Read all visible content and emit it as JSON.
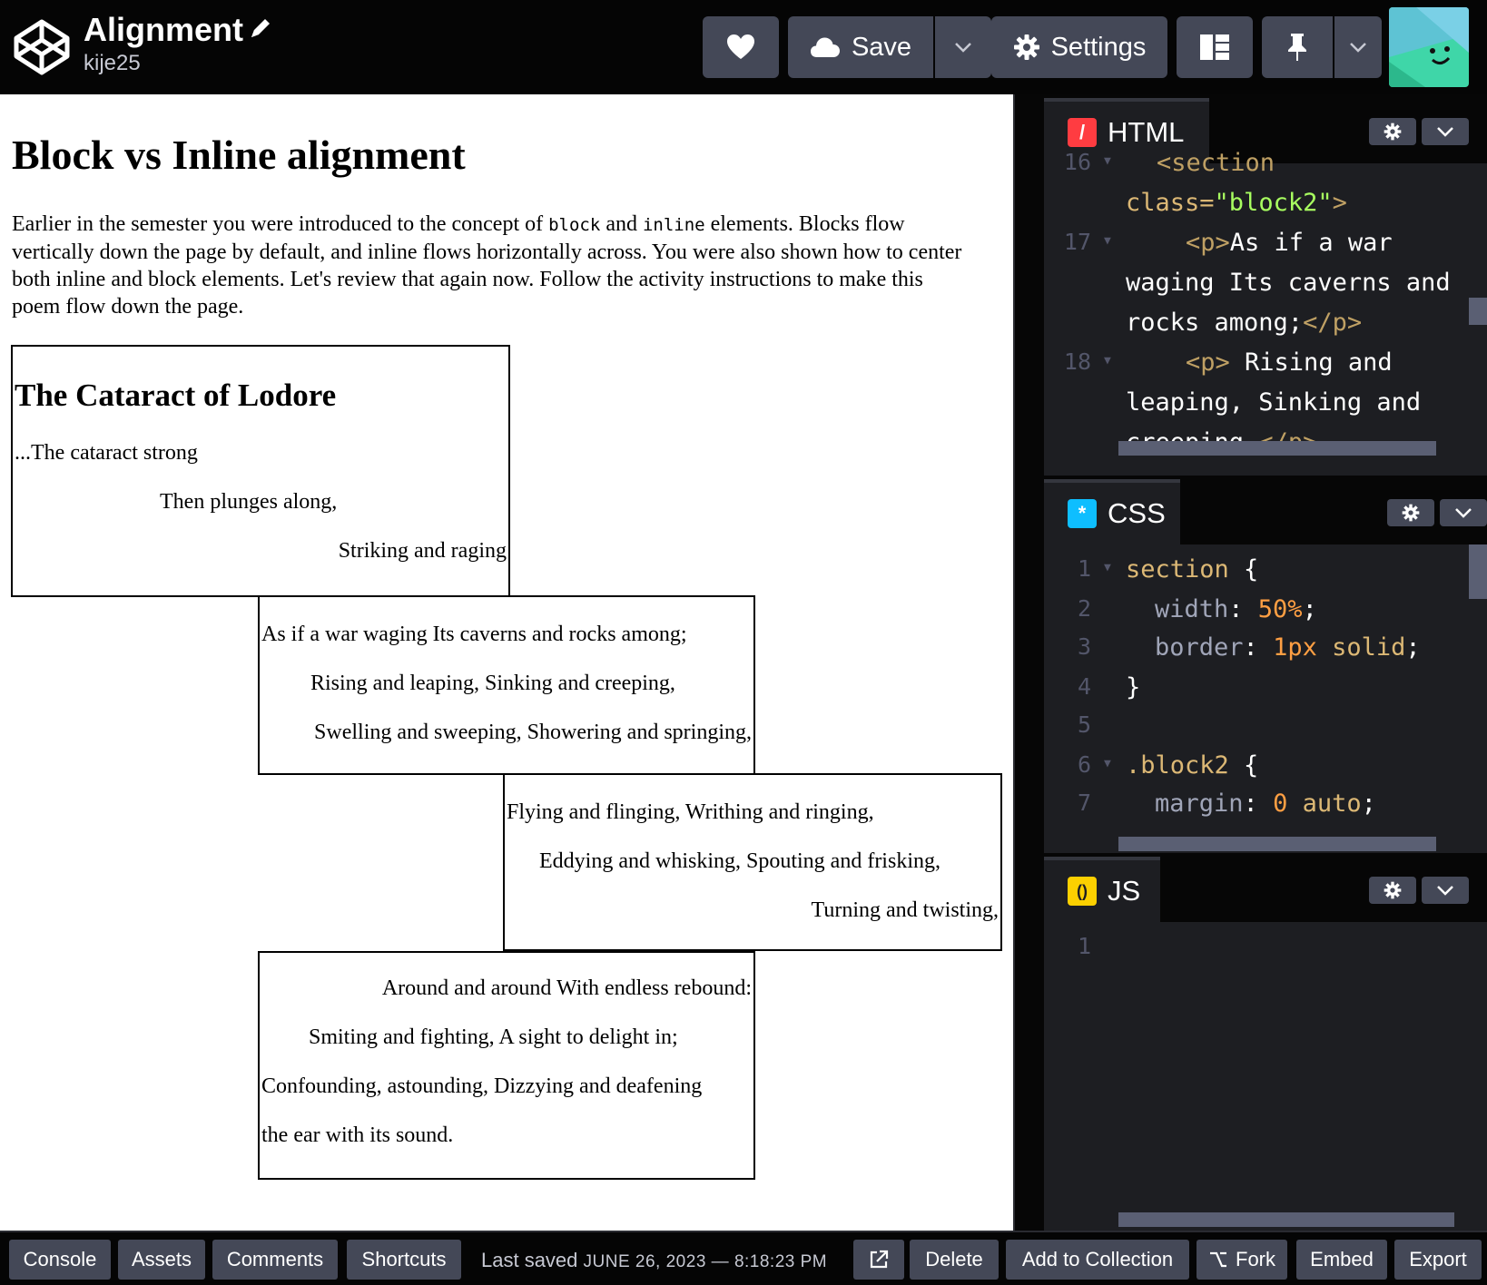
{
  "header": {
    "title": "Alignment",
    "username": "kije25",
    "buttons": {
      "save": "Save",
      "settings": "Settings"
    },
    "icons": [
      "codepen-logo-icon",
      "pencil-icon",
      "heart-icon",
      "cloud-icon",
      "chevron-down-icon",
      "gear-icon",
      "layout-icon",
      "pin-icon"
    ]
  },
  "preview": {
    "heading": "Block vs Inline alignment",
    "intro": {
      "p1": "Earlier in the semester you were introduced to the concept of ",
      "code1": "block",
      "p2": " and ",
      "code2": "inline",
      "p3": " elements. Blocks flow vertically down the page by default, and inline flows horizontally across. You were also shown how to center both inline and block elements. Let's review that again now. Follow the activity instructions to make this poem flow down the page."
    },
    "poem_title": "The Cataract of Lodore",
    "blocks": [
      {
        "lines": [
          "...The cataract strong",
          "Then plunges along,",
          "Striking and raging"
        ]
      },
      {
        "lines": [
          "As if a war waging Its caverns and rocks among;",
          "Rising and leaping, Sinking and creeping,",
          "Swelling and sweeping, Showering and springing,"
        ]
      },
      {
        "lines": [
          "Flying and flinging, Writhing and ringing,",
          "Eddying and whisking, Spouting and frisking,",
          "Turning and twisting,"
        ]
      },
      {
        "lines": [
          "Around and around With endless rebound:",
          "Smiting and fighting, A sight to delight in;",
          "Confounding, astounding, Dizzying and deafening",
          "the ear with its sound."
        ]
      }
    ],
    "size_badge": "558px"
  },
  "editors": {
    "html": {
      "name": "HTML",
      "badge": "/",
      "line_numbers": [
        "16",
        "17",
        "18"
      ],
      "code": {
        "l16_tag": "<section",
        "l16b_attr": "class=",
        "l16b_str": "\"block2\"",
        "l16b_close": ">",
        "l17_open": "<p>",
        "l17_text": "As if a war",
        "l17b_text": "waging Its caverns and",
        "l17c_text": "rocks among;",
        "l17c_close": "</p>",
        "l18_open": "<p>",
        "l18_text": " Rising and",
        "l18b_text": "leaping, Sinking and",
        "l18c_text": "creeping,",
        "l18c_close": "</p>"
      }
    },
    "css": {
      "name": "CSS",
      "badge": "*",
      "line_numbers": [
        "1",
        "2",
        "3",
        "4",
        "5",
        "6",
        "7"
      ],
      "code": {
        "l1_sel": "section",
        "l1_brace": " {",
        "l2_prop": "width",
        "l2_val": "50%",
        "l3_prop": "border",
        "l3_num": "1px",
        "l3_kw": " solid",
        "l4": "}",
        "l6_sel": ".block2",
        "l6_brace": " {",
        "l7_prop": "margin",
        "l7_num": "0",
        "l7_kw": " auto"
      }
    },
    "js": {
      "name": "JS",
      "badge": "()",
      "line_numbers": [
        "1"
      ]
    }
  },
  "footer": {
    "console": "Console",
    "assets": "Assets",
    "comments": "Comments",
    "shortcuts": "Shortcuts",
    "last_saved_label": "Last saved",
    "last_saved_value": "JUNE 26, 2023 — 8:18:23 PM",
    "delete": "Delete",
    "add_to_collection": "Add to Collection",
    "fork": "Fork",
    "embed": "Embed",
    "export": "Export"
  },
  "colors": {
    "html_badge": "#ff3c41",
    "css_badge": "#0ebeff",
    "js_badge": "#fcd000",
    "button_bg": "#444857",
    "editor_bg": "#1d1e22"
  }
}
